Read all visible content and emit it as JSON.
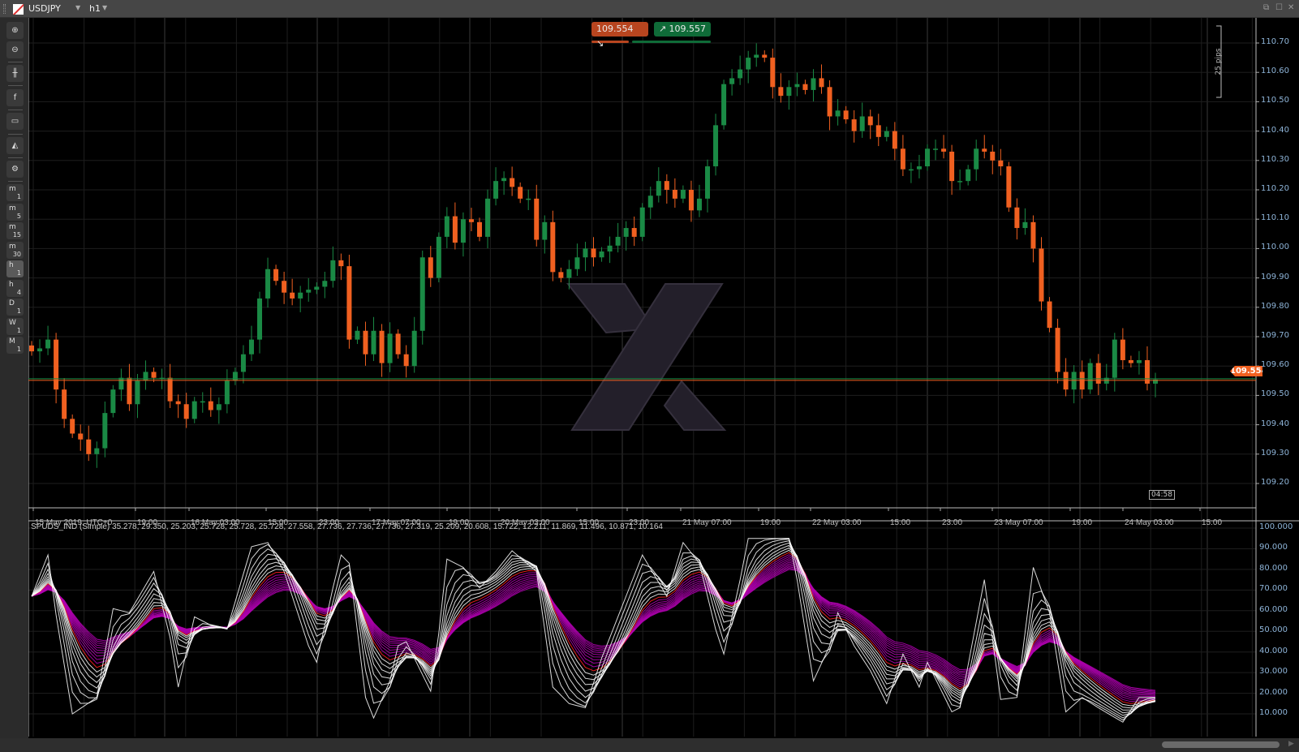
{
  "window": {
    "symbol": "USDJPY",
    "timeframe": "h1",
    "icons": [
      "symbol-flag-icon",
      "chevron-down-icon",
      "detach-icon",
      "maximize-icon",
      "close-icon"
    ]
  },
  "toolbar": {
    "tools": [
      "zoom-in-icon",
      "zoom-out-icon",
      "candlestick-icon",
      "facebook-icon",
      "bot-icon",
      "shapes-icon",
      "chart-settings-icon"
    ],
    "timeframes": [
      {
        "top": "m",
        "sub": "1"
      },
      {
        "top": "m",
        "sub": "5"
      },
      {
        "top": "m",
        "sub": "15"
      },
      {
        "top": "m",
        "sub": "30"
      },
      {
        "top": "h",
        "sub": "1"
      },
      {
        "top": "h",
        "sub": "4"
      },
      {
        "top": "D",
        "sub": "1"
      },
      {
        "top": "W",
        "sub": "1"
      },
      {
        "top": "M",
        "sub": "1"
      }
    ],
    "active_timeframe": "h1"
  },
  "trade": {
    "sell_price": "109.554",
    "buy_price": "109.557",
    "pips_label": "25 pips"
  },
  "current_price": "109.554",
  "countdown": "04:58",
  "colors": {
    "bull": "#1a8a45",
    "bear": "#f06020",
    "grid": "#1e1e1e",
    "axis_text": "#8eb4d8"
  },
  "time_axis": [
    "15 May 2019, UTC+0",
    "19:00",
    "16 May 03:00",
    "15:00",
    "23:00",
    "17 May 07:00",
    "19:00",
    "20 May 03:00",
    "15:00",
    "23:00",
    "21 May 07:00",
    "19:00",
    "22 May 03:00",
    "15:00",
    "23:00",
    "23 May 07:00",
    "19:00",
    "24 May 03:00",
    "15:00"
  ],
  "indicator": {
    "name": "SPUDS_IND (Simple)",
    "values": "35.278, 29.350, 25.203, 25.728, 25.728, 25.728, 27.558, 27.736, 27.736, 27.736, 27.319, 25.209, 20.608, 15.722, 12.211, 11.869, 11.496, 10.871, 10.164"
  },
  "chart_data": [
    {
      "type": "candlestick",
      "symbol": "USDJPY",
      "timeframe": "h1",
      "ylim": [
        109.13,
        110.75
      ],
      "yticks": [
        "110.70",
        "110.60",
        "110.50",
        "110.40",
        "110.30",
        "110.20",
        "110.10",
        "110.00",
        "109.90",
        "109.80",
        "109.70",
        "109.60",
        "109.50",
        "109.40",
        "109.30",
        "109.20"
      ],
      "closes": [
        109.65,
        109.66,
        109.69,
        109.52,
        109.42,
        109.37,
        109.35,
        109.3,
        109.32,
        109.44,
        109.52,
        109.56,
        109.47,
        109.55,
        109.58,
        109.56,
        109.56,
        109.48,
        109.47,
        109.42,
        109.48,
        109.48,
        109.45,
        109.47,
        109.55,
        109.58,
        109.64,
        109.69,
        109.83,
        109.93,
        109.89,
        109.85,
        109.83,
        109.85,
        109.86,
        109.87,
        109.89,
        109.96,
        109.94,
        109.69,
        109.72,
        109.64,
        109.72,
        109.61,
        109.71,
        109.64,
        109.6,
        109.72,
        109.97,
        109.9,
        110.04,
        110.11,
        110.02,
        110.1,
        110.09,
        110.04,
        110.17,
        110.23,
        110.24,
        110.21,
        110.17,
        110.17,
        110.03,
        110.09,
        109.92,
        109.9,
        109.93,
        109.97,
        110.0,
        109.97,
        109.99,
        110.01,
        110.04,
        110.07,
        110.04,
        110.14,
        110.18,
        110.23,
        110.2,
        110.17,
        110.2,
        110.13,
        110.17,
        110.28,
        110.42,
        110.56,
        110.58,
        110.61,
        110.65,
        110.66,
        110.65,
        110.55,
        110.52,
        110.55,
        110.56,
        110.54,
        110.58,
        110.55,
        110.45,
        110.47,
        110.44,
        110.4,
        110.45,
        110.42,
        110.38,
        110.4,
        110.34,
        110.27,
        110.27,
        110.28,
        110.34,
        110.34,
        110.33,
        110.23,
        110.23,
        110.27,
        110.34,
        110.33,
        110.3,
        110.28,
        110.14,
        110.07,
        110.09,
        110.0,
        109.82,
        109.73,
        109.58,
        109.52,
        109.58,
        109.52,
        109.61,
        109.54,
        109.56,
        109.69,
        109.62,
        109.61,
        109.62,
        109.54,
        109.554
      ]
    },
    {
      "type": "line",
      "name": "SPUDS_IND (Simple)",
      "ylim": [
        0,
        100
      ],
      "yticks": [
        "100.000",
        "90.000",
        "80.000",
        "70.000",
        "60.000",
        "50.000",
        "40.000",
        "30.000",
        "20.000",
        "10.000"
      ],
      "base_points": [
        [
          0,
          67
        ],
        [
          2,
          87
        ],
        [
          3,
          58
        ],
        [
          5,
          10
        ],
        [
          8,
          18
        ],
        [
          10,
          61
        ],
        [
          12,
          59
        ],
        [
          15,
          79
        ],
        [
          17,
          47
        ],
        [
          18,
          23
        ],
        [
          20,
          57
        ],
        [
          22,
          53
        ],
        [
          24,
          51
        ],
        [
          27,
          91
        ],
        [
          29,
          93
        ],
        [
          31,
          79
        ],
        [
          34,
          43
        ],
        [
          35,
          35
        ],
        [
          37,
          71
        ],
        [
          38,
          87
        ],
        [
          39,
          83
        ],
        [
          41,
          18
        ],
        [
          42,
          8
        ],
        [
          44,
          26
        ],
        [
          45,
          43
        ],
        [
          46,
          45
        ],
        [
          49,
          21
        ],
        [
          50,
          49
        ],
        [
          51,
          85
        ],
        [
          53,
          81
        ],
        [
          55,
          71
        ],
        [
          57,
          79
        ],
        [
          59,
          89
        ],
        [
          62,
          79
        ],
        [
          64,
          23
        ],
        [
          66,
          15
        ],
        [
          68,
          13
        ],
        [
          70,
          37
        ],
        [
          73,
          67
        ],
        [
          75,
          87
        ],
        [
          78,
          67
        ],
        [
          80,
          93
        ],
        [
          82,
          83
        ],
        [
          84,
          51
        ],
        [
          85,
          39
        ],
        [
          87,
          75
        ],
        [
          88,
          95
        ],
        [
          91,
          95
        ],
        [
          93,
          95
        ],
        [
          94,
          75
        ],
        [
          96,
          26
        ],
        [
          98,
          43
        ],
        [
          99,
          59
        ],
        [
          101,
          43
        ],
        [
          103,
          31
        ],
        [
          105,
          15
        ],
        [
          107,
          39
        ],
        [
          109,
          23
        ],
        [
          110,
          35
        ],
        [
          113,
          11
        ],
        [
          114,
          13
        ],
        [
          117,
          75
        ],
        [
          119,
          17
        ],
        [
          121,
          18
        ],
        [
          123,
          81
        ],
        [
          125,
          59
        ],
        [
          127,
          11
        ],
        [
          129,
          18
        ],
        [
          131,
          13
        ],
        [
          134,
          6
        ],
        [
          136,
          18
        ],
        [
          138,
          18
        ],
        [
          140,
          73
        ],
        [
          142,
          47
        ],
        [
          143,
          45
        ],
        [
          146,
          26
        ]
      ],
      "series_colors": {
        "fast": "#ffffff",
        "signal": "#ff2020",
        "slow": "#b000b0"
      }
    }
  ]
}
